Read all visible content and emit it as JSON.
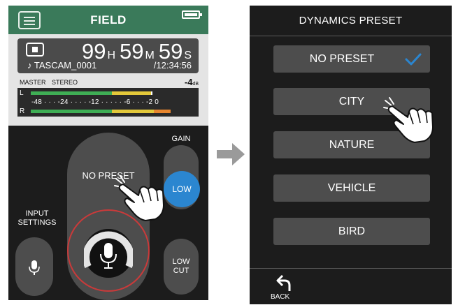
{
  "left_screen": {
    "title": "FIELD",
    "timecode": {
      "hours": "99",
      "h_unit": "H",
      "minutes": "59",
      "m_unit": "M",
      "seconds": "59",
      "s_unit": "S"
    },
    "file_name": "♪ TASCAM_0001",
    "remaining_time": "/12:34:56",
    "meter": {
      "master_label": "MASTER",
      "mode_label": "STEREO",
      "level_value": "-4",
      "level_unit": "dB",
      "left_channel": "L",
      "right_channel": "R",
      "scale": "-48 · · · -24 · · · · -12 · · · · · -6 · · · -2 0"
    },
    "preset_knob_label": "NO PRESET",
    "gain_label": "GAIN",
    "gain_value": "LOW",
    "input_settings_label": "INPUT\nSETTINGS",
    "low_cut_label": "LOW\nCUT",
    "colors": {
      "header": "#3a7a5a",
      "gain_selected": "#2b86d0",
      "record_ring": "#c93a3a"
    }
  },
  "right_screen": {
    "title": "DYNAMICS PRESET",
    "presets": [
      {
        "label": "NO PRESET",
        "selected": true
      },
      {
        "label": "CITY",
        "selected": false
      },
      {
        "label": "NATURE",
        "selected": false
      },
      {
        "label": "VEHICLE",
        "selected": false
      },
      {
        "label": "BIRD",
        "selected": false
      }
    ],
    "back_label": "BACK",
    "colors": {
      "check": "#2b86d0"
    }
  },
  "icons": [
    "menu-icon",
    "battery-icon",
    "stop-icon",
    "mic-icon",
    "arrow-right-icon",
    "checkmark-icon",
    "back-icon",
    "tap-hand-icon"
  ]
}
